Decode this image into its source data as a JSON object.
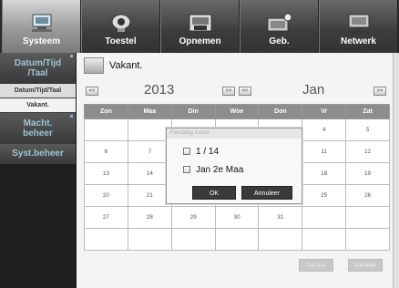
{
  "tabs": [
    {
      "label": "Systeem",
      "icon": "system-icon",
      "active": true
    },
    {
      "label": "Toestel",
      "icon": "camera-icon",
      "active": false
    },
    {
      "label": "Opnemen",
      "icon": "record-icon",
      "active": false
    },
    {
      "label": "Geb.",
      "icon": "event-icon",
      "active": false
    },
    {
      "label": "Netwerk",
      "icon": "network-icon",
      "active": false
    }
  ],
  "sidebar": {
    "datetime": "Datum/Tijd\n/Taal",
    "sub1": "Datum/Tijd/Taal",
    "sub2": "Vakant.",
    "power": "Macht.\nbeheer",
    "sysmgmt": "Syst.beheer"
  },
  "panel": {
    "title": "Vakant.",
    "year": "2013",
    "month": "Jan",
    "nav": [
      "<<",
      ">>",
      "<<",
      ">>"
    ]
  },
  "calendar": {
    "headers": [
      "Zon",
      "Maa",
      "Din",
      "Woe",
      "Don",
      "Vr",
      "Zat"
    ],
    "rows": [
      [
        "",
        "",
        "",
        "",
        "",
        "4",
        "5"
      ],
      [
        "6",
        "7",
        "",
        "",
        "",
        "11",
        "12"
      ],
      [
        "13",
        "14",
        "",
        "",
        "",
        "18",
        "19"
      ],
      [
        "20",
        "21",
        "",
        "",
        "",
        "25",
        "26"
      ],
      [
        "27",
        "28",
        "29",
        "30",
        "31",
        "",
        ""
      ],
      [
        "",
        "",
        "",
        "",
        "",
        "",
        ""
      ]
    ]
  },
  "popup": {
    "title": "Feestdag instelt",
    "items": [
      "1 / 14",
      "Jan 2e Maa"
    ],
    "ok": "OK",
    "cancel": "Annuleer"
  },
  "bottom": {
    "apply": "Fes toe",
    "cancel": "Annuleer"
  }
}
